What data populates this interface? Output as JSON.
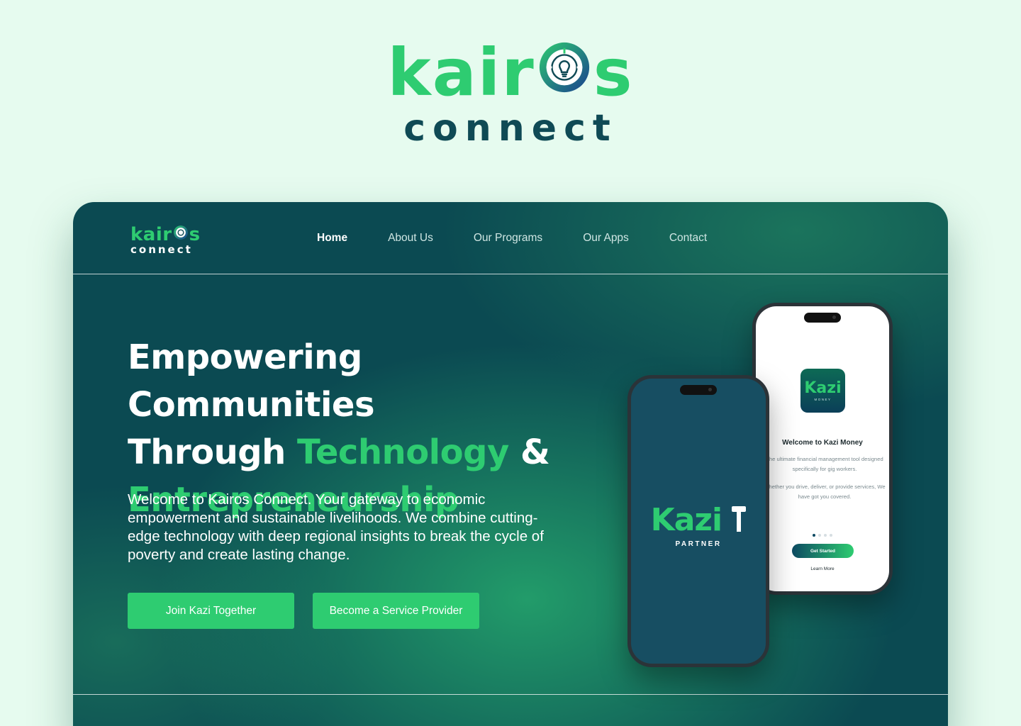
{
  "brand": {
    "logo_word_left": "kair",
    "logo_word_right": "s",
    "logo_subword": "connect",
    "colors": {
      "green": "#2ecc71",
      "dark_teal": "#0b4a52",
      "page_bg": "#e6fbef"
    }
  },
  "nav": {
    "logo_word_left": "kair",
    "logo_word_right": "s",
    "logo_subword": "connect",
    "links": [
      {
        "label": "Home",
        "active": true
      },
      {
        "label": "About Us",
        "active": false
      },
      {
        "label": "Our Programs",
        "active": false
      },
      {
        "label": "Our Apps",
        "active": false
      },
      {
        "label": "Contact",
        "active": false
      }
    ]
  },
  "hero": {
    "headline_line1": "Empowering Communities",
    "headline_line2_start": "Through ",
    "headline_line2_highlight": "Technology",
    "headline_line2_end": " &",
    "headline_line3": "Entrepreneurship",
    "intro": "Welcome to Kairos Connect. Your gateway to economic empowerment and sustainable livelihoods. We combine cutting-edge technology with deep regional insights to break the cycle of poverty and create lasting change.",
    "buttons": {
      "primary": "Join Kazi Together",
      "secondary": "Become a Service Provider"
    }
  },
  "phones": {
    "kazi_money": {
      "tile_logo": "Kazi",
      "tile_sub": "MONEY",
      "title": "Welcome to Kazi Money",
      "desc1": "The ultimate financial management tool designed specifically for gig workers.",
      "desc2": "Whether you drive, deliver, or provide services, We have got you covered.",
      "cta": "Get Started",
      "link": "Learn More",
      "page_index": 1,
      "page_count": 4
    },
    "kazi_partner": {
      "logo": "Kazi",
      "sub": "PARTNER"
    }
  },
  "icons": [
    "lightbulb-globe-icon",
    "hammer-icon"
  ]
}
